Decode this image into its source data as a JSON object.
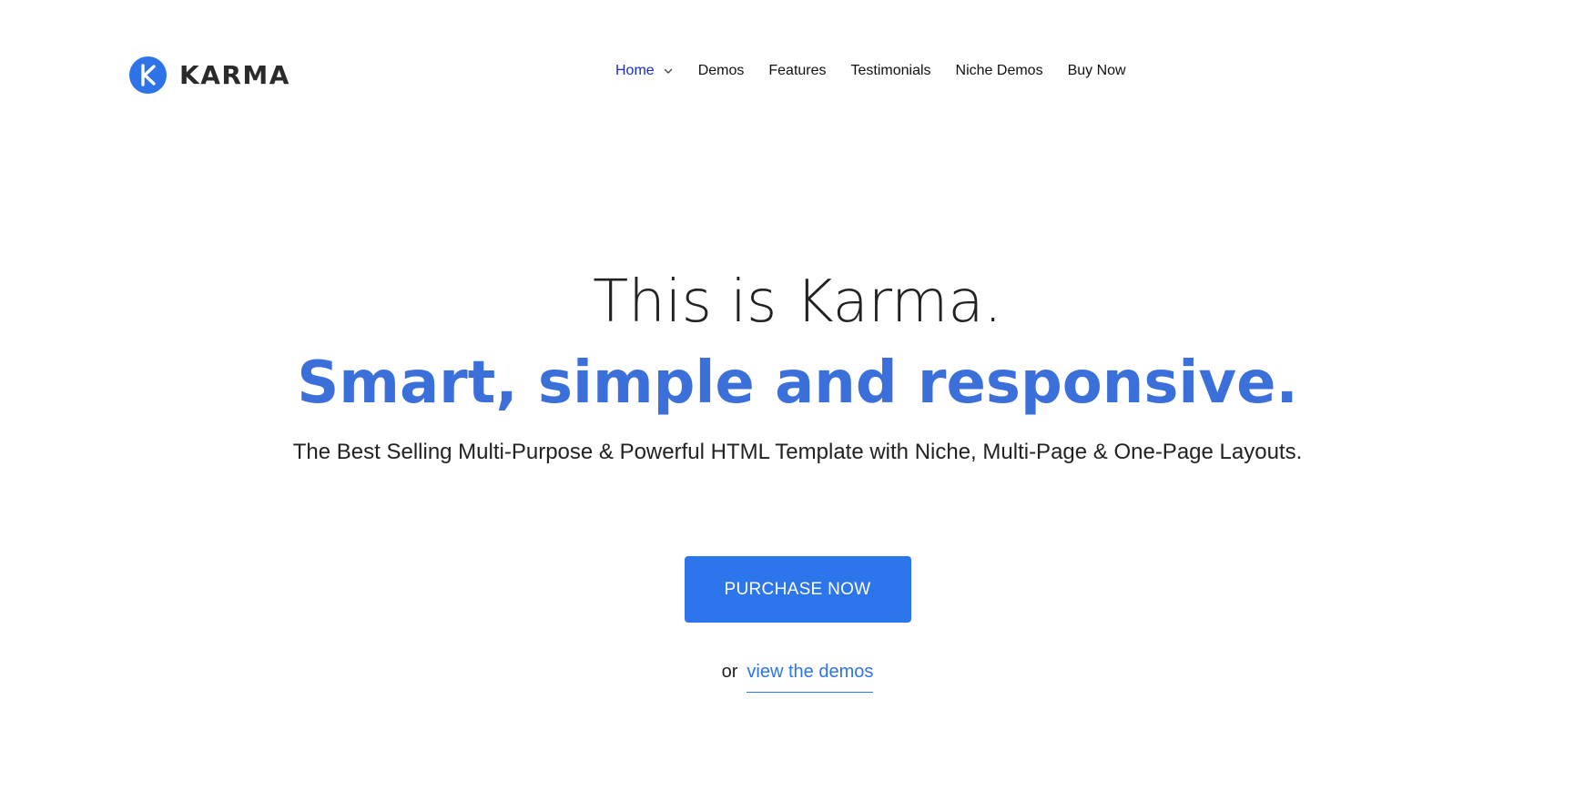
{
  "header": {
    "brand": {
      "name": "KARMA",
      "logo_icon": "k-logo-icon",
      "logo_color": "#2f73e8"
    },
    "nav": {
      "items": [
        {
          "label": "Home",
          "active": true,
          "has_dropdown": true
        },
        {
          "label": "Demos",
          "active": false
        },
        {
          "label": "Features",
          "active": false
        },
        {
          "label": "Testimonials",
          "active": false
        },
        {
          "label": "Niche Demos",
          "active": false
        },
        {
          "label": "Buy Now",
          "active": false
        }
      ],
      "active_color": "#1a2bd6"
    }
  },
  "hero": {
    "headline": "This is Karma.",
    "tagline": "Smart, simple and responsive.",
    "tagline_color": "#3b6fd9",
    "subtitle": "The Best Selling Multi-Purpose & Powerful HTML Template with Niche, Multi-Page & One-Page Layouts.",
    "cta": {
      "label": "PURCHASE NOW",
      "color": "#2c75ea"
    },
    "alternate": {
      "prefix": "or",
      "link_label": "view the demos"
    }
  }
}
